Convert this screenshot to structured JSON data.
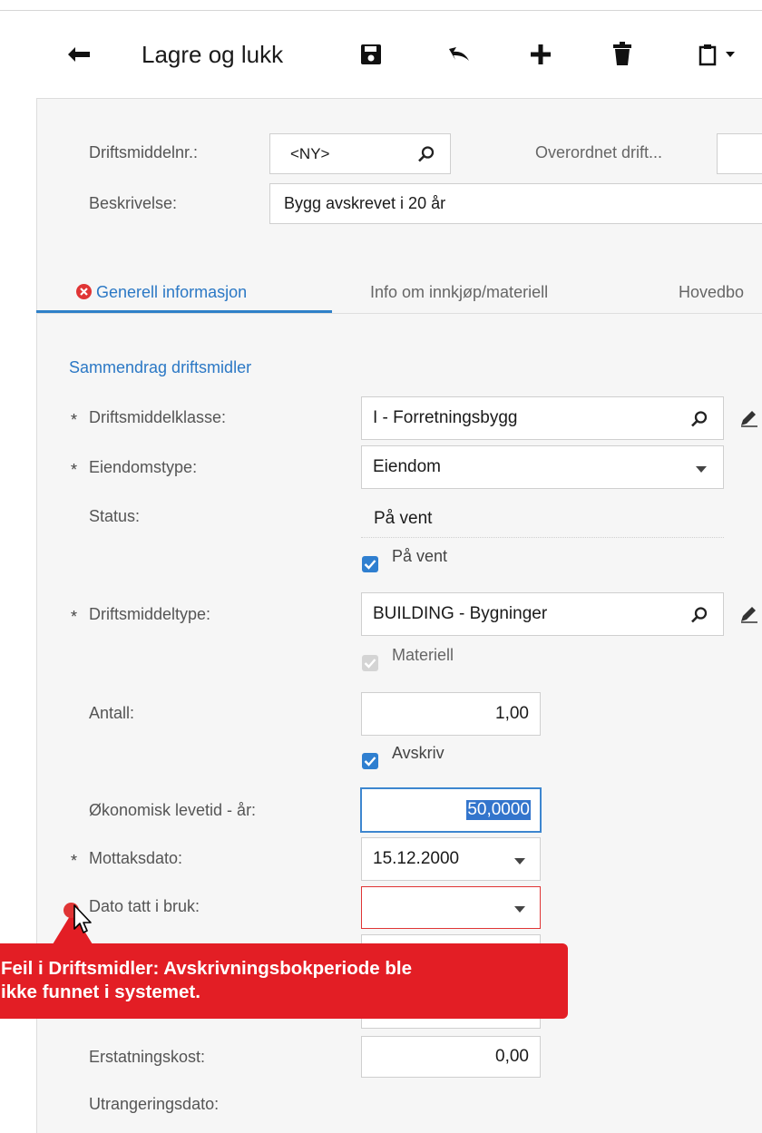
{
  "toolbar": {
    "back_icon": "arrow-left-icon",
    "save_close_label": "Lagre og lukk",
    "save_icon": "floppy-disk-icon",
    "undo_icon": "undo-icon",
    "add_icon": "plus-icon",
    "delete_icon": "trash-icon",
    "clipboard_icon": "clipboard-icon"
  },
  "header": {
    "asset_nr_label": "Driftsmiddelnr.:",
    "asset_nr_value": "<NY>",
    "parent_label": "Overordnet drift...",
    "description_label": "Beskrivelse:",
    "description_value": "Bygg avskrevet i 20 år"
  },
  "tabs": [
    {
      "label": "Generell informasjon",
      "active": true,
      "error": true
    },
    {
      "label": "Info om innkjøp/materiell",
      "active": false
    },
    {
      "label": "Hovedbo",
      "active": false
    }
  ],
  "section": {
    "title": "Sammendrag driftsmidler"
  },
  "form": {
    "required_mark": "*",
    "asset_class": {
      "label": "Driftsmiddelklasse:",
      "value": "I - Forretningsbygg"
    },
    "property_type": {
      "label": "Eiendomstype:",
      "value": "Eiendom"
    },
    "status": {
      "label": "Status:",
      "value": "På vent"
    },
    "on_hold": {
      "label": "På vent",
      "checked": true
    },
    "asset_type": {
      "label": "Driftsmiddeltype:",
      "value": "BUILDING - Bygninger"
    },
    "material": {
      "label": "Materiell",
      "checked": true,
      "disabled": true
    },
    "quantity": {
      "label": "Antall:",
      "value": "1,00"
    },
    "depreciate": {
      "label": "Avskriv",
      "checked": true
    },
    "useful_life": {
      "label": "Økonomisk levetid - år:",
      "value": "50,0000"
    },
    "receipt_date": {
      "label": "Mottaksdato:",
      "value": "15.12.2000"
    },
    "in_use_date": {
      "label": "Dato tatt i bruk:",
      "value": ""
    },
    "replacement_cost": {
      "label": "Erstatningskost:",
      "value": "0,00"
    },
    "disposal_date": {
      "label": "Utrangeringsdato:"
    }
  },
  "error_tooltip": {
    "line1": "Feil i Driftsmidler: Avskrivningsbokperiode ble",
    "line2": "ikke funnet i systemet."
  },
  "colors": {
    "accent": "#2b78c5",
    "error": "#e31e25",
    "checkbox": "#2f7fd0"
  }
}
